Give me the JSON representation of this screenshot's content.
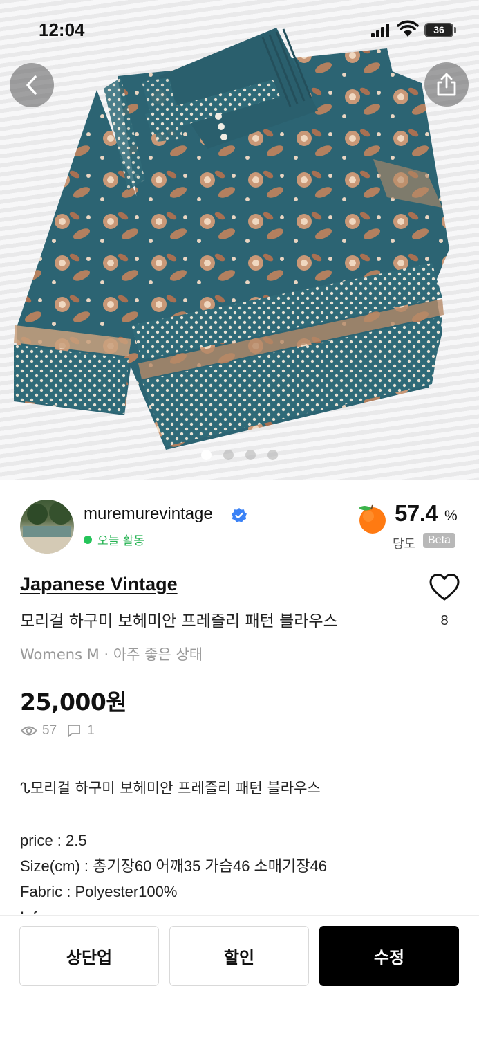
{
  "status_bar": {
    "time": "12:04",
    "battery": "36"
  },
  "gallery": {
    "total": 4,
    "active_index": 0
  },
  "seller": {
    "name": "muremurevintage",
    "activity": "오늘 활동",
    "score_value": "57.4",
    "score_unit": "%",
    "score_label": "당도",
    "score_badge": "Beta"
  },
  "product": {
    "brand": "Japanese Vintage",
    "title": "모리걸 하구미 보헤미안 프레즐리 패턴 블라우스",
    "meta": "Womens M · 아주 좋은 상태",
    "price": "25,000원",
    "likes": "8",
    "views": "57",
    "comments": "1",
    "description": {
      "line1": "ᔐ모리걸 하구미 보헤미안 프레즐리 패턴 블라우스",
      "line2": "price : 2.5",
      "line3": "Size(cm) : 총기장60 어깨35 가슴46 소매기장46",
      "line4": "Fabric : Polyester100%",
      "line5": "Info :"
    }
  },
  "actions": {
    "bump": "상단업",
    "discount": "할인",
    "edit": "수정"
  },
  "colors": {
    "primary_button": "#000000",
    "activity_green": "#25c45a",
    "verified_blue": "#3b82f6",
    "garment_teal": "#2f6a78"
  }
}
